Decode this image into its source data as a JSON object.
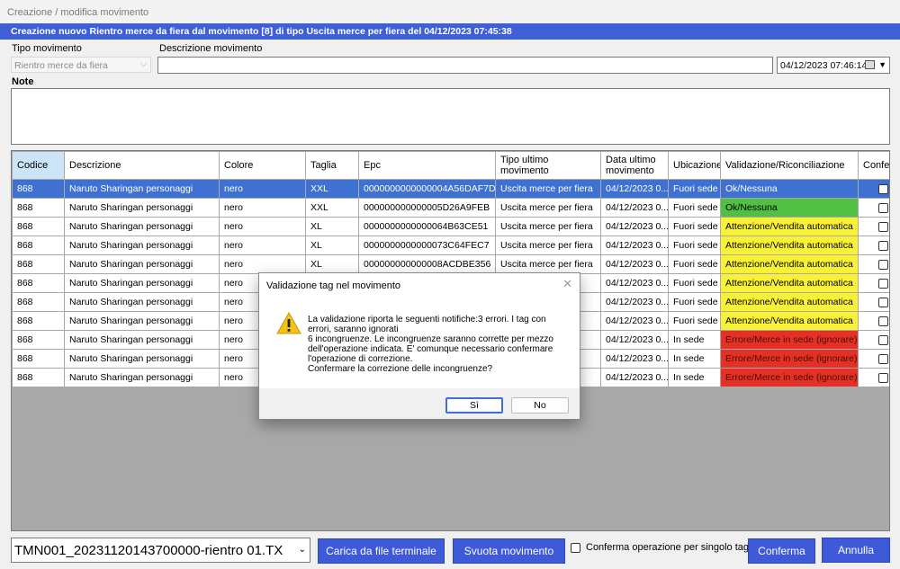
{
  "window": {
    "title": "Creazione / modifica movimento"
  },
  "banner": {
    "text": "Creazione nuovo Rientro merce da fiera dal movimento [8] di tipo Uscita merce per fiera del 04/12/2023 07:45:38"
  },
  "form": {
    "tipo_label": "Tipo movimento",
    "tipo_value": "Rientro merce da fiera",
    "descrizione_label": "Descrizione movimento",
    "descrizione_value": "",
    "date_value": "04/12/2023 07:46:14",
    "note_label": "Note",
    "note_value": ""
  },
  "grid": {
    "columns": [
      "Codice",
      "Descrizione",
      "Colore",
      "Taglia",
      "Epc",
      "Tipo ultimo movimento",
      "Data ultimo movimento",
      "Ubicazione",
      "Validazione/Riconciliazione",
      "Confe"
    ],
    "rows": [
      {
        "codice": "868",
        "descrizione": "Naruto Sharingan personaggi",
        "colore": "nero",
        "taglia": "XXL",
        "epc": "0000000000000004A56DAF7D",
        "tipo": "Uscita merce per fiera",
        "data": "04/12/2023 0...",
        "ubicazione": "Fuori sede",
        "validazione": "Ok/Nessuna",
        "status": "ok",
        "selected": true
      },
      {
        "codice": "868",
        "descrizione": "Naruto Sharingan personaggi",
        "colore": "nero",
        "taglia": "XXL",
        "epc": "000000000000005D26A9FEB",
        "tipo": "Uscita merce per fiera",
        "data": "04/12/2023 0...",
        "ubicazione": "Fuori sede",
        "validazione": "Ok/Nessuna",
        "status": "ok",
        "selected": false
      },
      {
        "codice": "868",
        "descrizione": "Naruto Sharingan personaggi",
        "colore": "nero",
        "taglia": "XL",
        "epc": "0000000000000064B63CE51",
        "tipo": "Uscita merce per fiera",
        "data": "04/12/2023 0...",
        "ubicazione": "Fuori sede",
        "validazione": "Attenzione/Vendita automatica",
        "status": "warn",
        "selected": false
      },
      {
        "codice": "868",
        "descrizione": "Naruto Sharingan personaggi",
        "colore": "nero",
        "taglia": "XL",
        "epc": "0000000000000073C64FEC7",
        "tipo": "Uscita merce per fiera",
        "data": "04/12/2023 0...",
        "ubicazione": "Fuori sede",
        "validazione": "Attenzione/Vendita automatica",
        "status": "warn",
        "selected": false
      },
      {
        "codice": "868",
        "descrizione": "Naruto Sharingan personaggi",
        "colore": "nero",
        "taglia": "XL",
        "epc": "000000000000008ACDBE356",
        "tipo": "Uscita merce per fiera",
        "data": "04/12/2023 0...",
        "ubicazione": "Fuori sede",
        "validazione": "Attenzione/Vendita automatica",
        "status": "warn",
        "selected": false
      },
      {
        "codice": "868",
        "descrizione": "Naruto Sharingan personaggi",
        "colore": "nero",
        "taglia": "",
        "epc": "",
        "tipo": "a",
        "data": "04/12/2023 0...",
        "ubicazione": "Fuori sede",
        "validazione": "Attenzione/Vendita automatica",
        "status": "warn",
        "selected": false
      },
      {
        "codice": "868",
        "descrizione": "Naruto Sharingan personaggi",
        "colore": "nero",
        "taglia": "",
        "epc": "",
        "tipo": "a",
        "data": "04/12/2023 0...",
        "ubicazione": "Fuori sede",
        "validazione": "Attenzione/Vendita automatica",
        "status": "warn",
        "selected": false
      },
      {
        "codice": "868",
        "descrizione": "Naruto Sharingan personaggi",
        "colore": "nero",
        "taglia": "",
        "epc": "",
        "tipo": "a",
        "data": "04/12/2023 0...",
        "ubicazione": "Fuori sede",
        "validazione": "Attenzione/Vendita automatica",
        "status": "warn",
        "selected": false
      },
      {
        "codice": "868",
        "descrizione": "Naruto Sharingan personaggi",
        "colore": "nero",
        "taglia": "",
        "epc": "",
        "tipo": "",
        "data": "04/12/2023 0...",
        "ubicazione": "In sede",
        "validazione": "Errore/Merce in sede (ignorare)",
        "status": "err",
        "selected": false
      },
      {
        "codice": "868",
        "descrizione": "Naruto Sharingan personaggi",
        "colore": "nero",
        "taglia": "",
        "epc": "",
        "tipo": "",
        "data": "04/12/2023 0...",
        "ubicazione": "In sede",
        "validazione": "Errore/Merce in sede (ignorare)",
        "status": "err",
        "selected": false
      },
      {
        "codice": "868",
        "descrizione": "Naruto Sharingan personaggi",
        "colore": "nero",
        "taglia": "",
        "epc": "",
        "tipo": "",
        "data": "04/12/2023 0...",
        "ubicazione": "In sede",
        "validazione": "Errore/Merce in sede (ignorare)",
        "status": "err",
        "selected": false
      }
    ]
  },
  "bottom": {
    "file_value": "TMN001_20231120143700000-rientro 01.TX",
    "load_label": "Carica da file terminale",
    "clear_label": "Svuota movimento",
    "single_label": "Conferma operazione per singolo tag",
    "confirm_label": "Conferma",
    "cancel_label": "Annulla"
  },
  "dialog": {
    "title": "Validazione tag nel movimento",
    "close_glyph": "✕",
    "icon": "warning-icon",
    "message": "La validazione riporta le seguenti notifiche:3 errori. I tag con errori, saranno ignorati\n6 incongruenze. Le incongruenze saranno corrette per mezzo dell'operazione indicata. E' comunque necessario confermare l'operazione di correzione.\nConfermare la correzione delle incongruenze?",
    "yes_label": "Sì",
    "no_label": "No"
  },
  "colors": {
    "accent": "#3f5fd6",
    "ok": "#50c042",
    "warn": "#f8f136",
    "err": "#e53125",
    "selected": "#3f71d2"
  }
}
